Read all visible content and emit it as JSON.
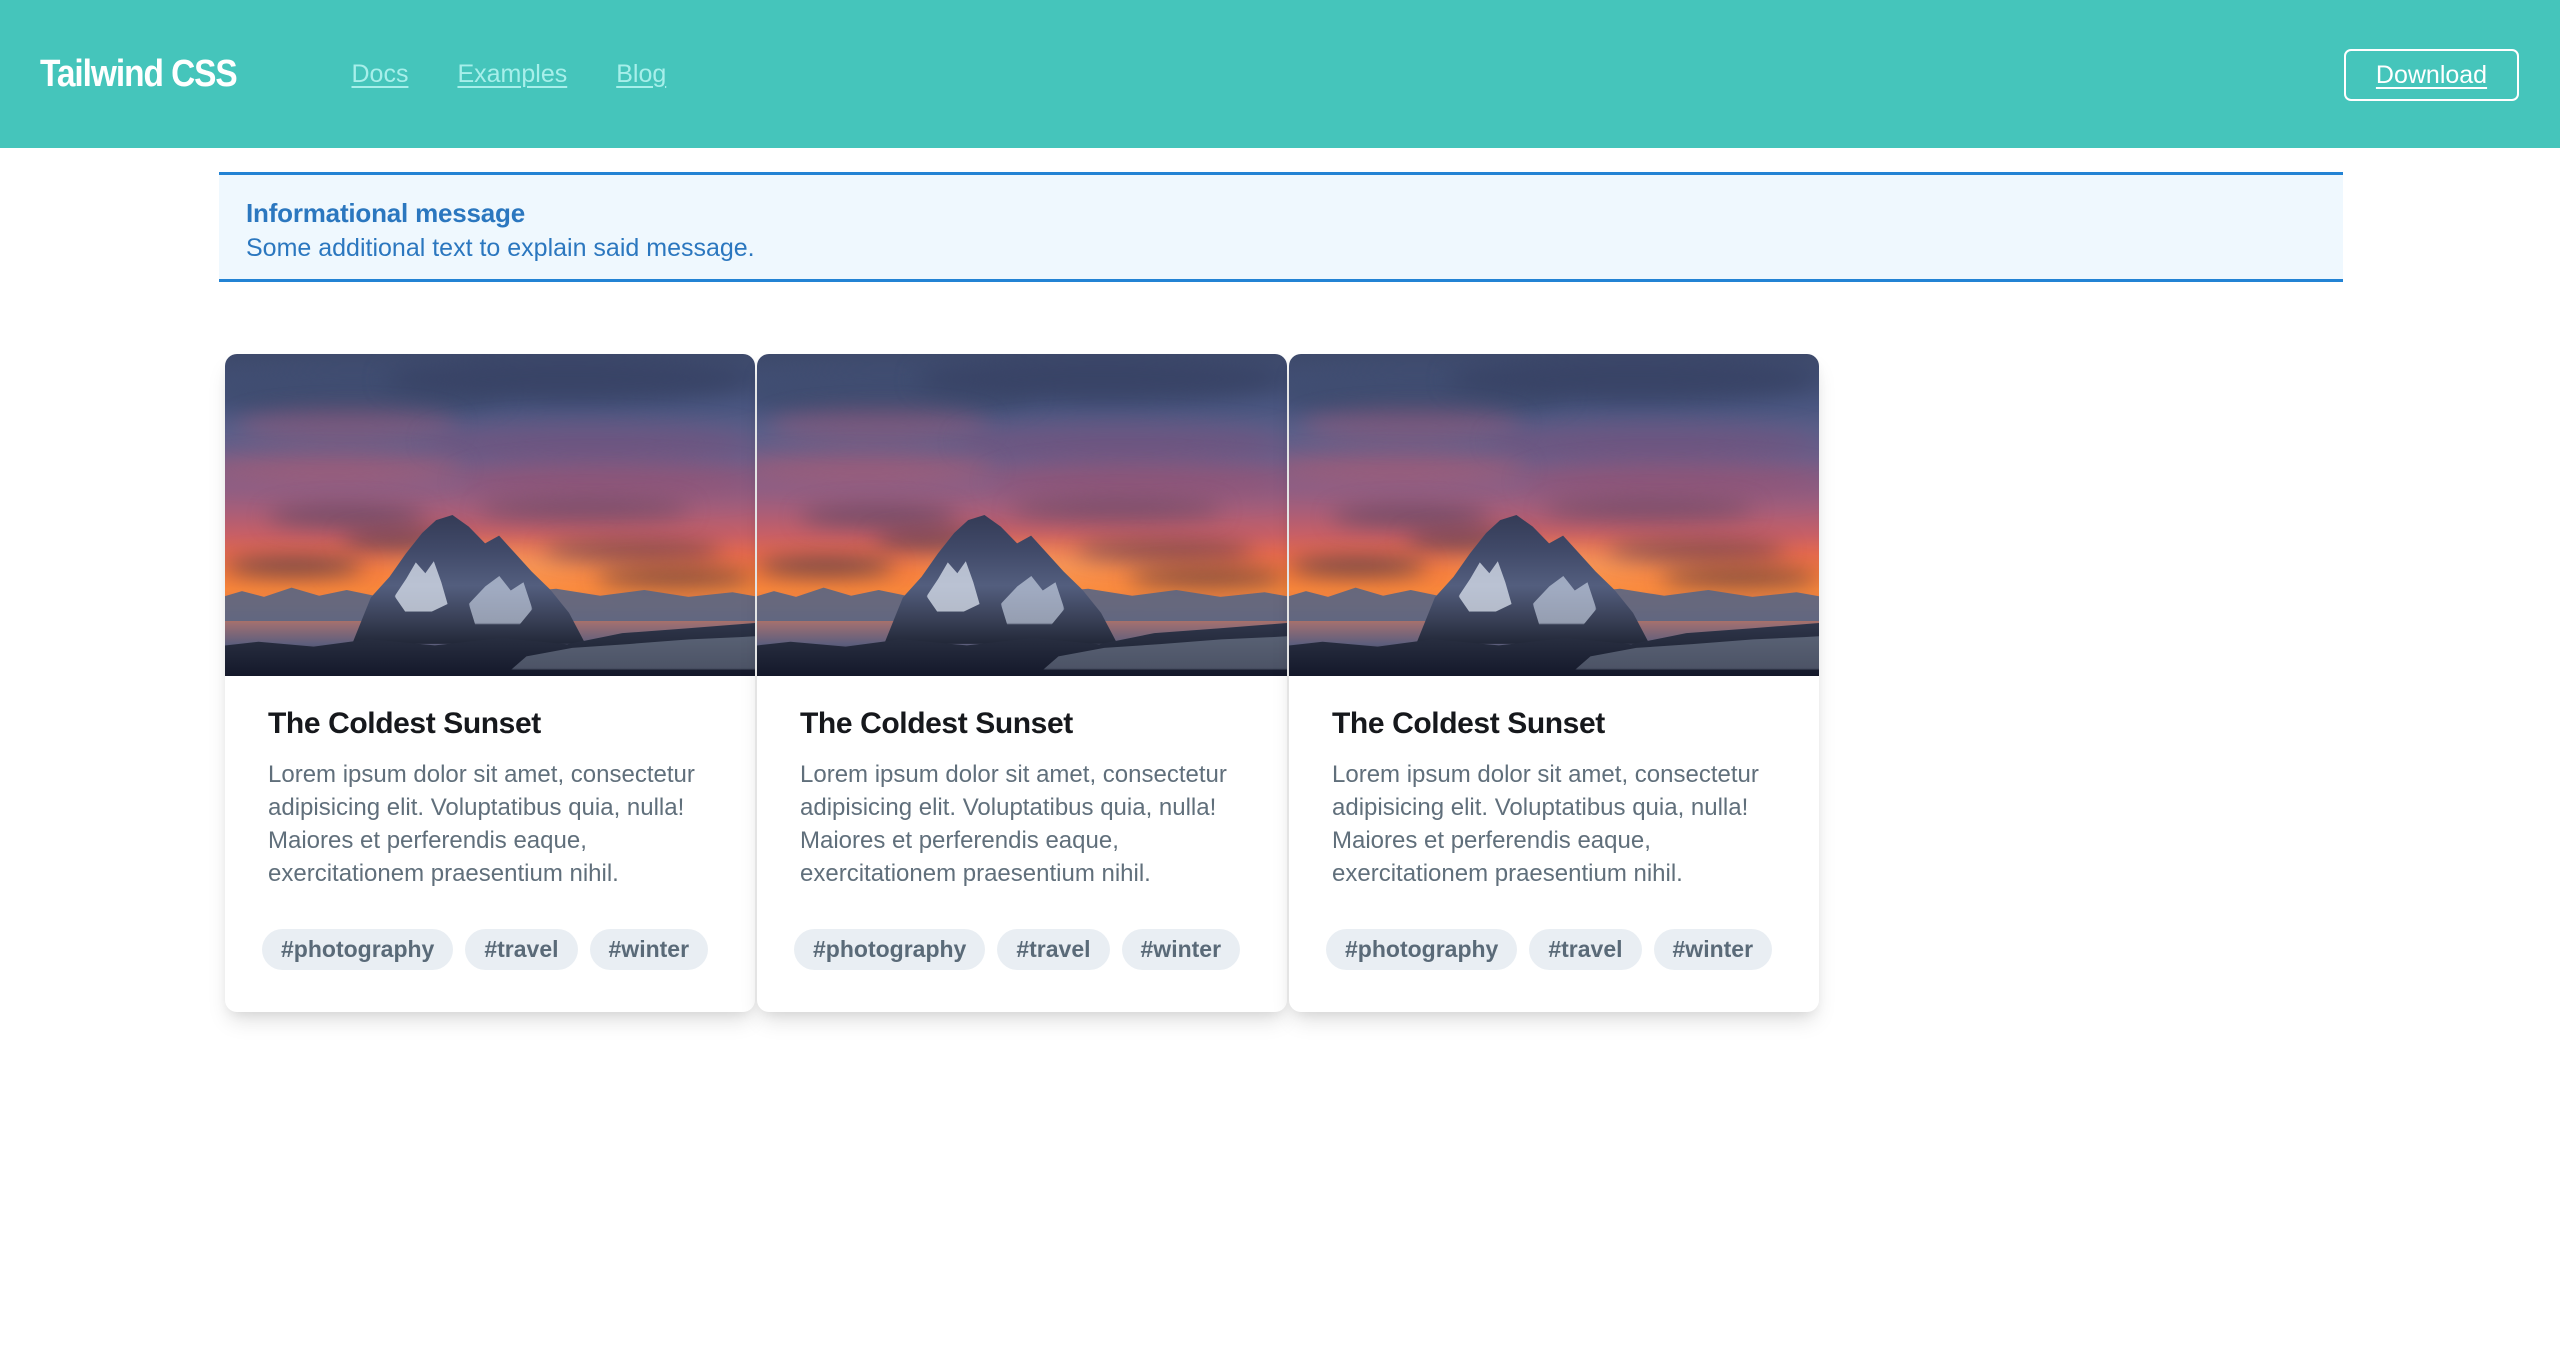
{
  "theme": {
    "nav_bg": "#45c5bb",
    "nav_link_color": "#a7efea",
    "alert_bg": "#eff8fe",
    "alert_border": "#2383d4",
    "alert_text": "#2b77bf",
    "tag_bg": "#e9eef3",
    "tag_text": "#5a6a78",
    "card_text": "#606f7b",
    "page_bg": "#ffffff"
  },
  "navbar": {
    "brand": "Tailwind CSS",
    "links": [
      {
        "label": "Docs"
      },
      {
        "label": "Examples"
      },
      {
        "label": "Blog"
      }
    ],
    "download_label": "Download"
  },
  "alert": {
    "title": "Informational message",
    "body": "Some additional text to explain said message."
  },
  "cards": [
    {
      "image_alt": "mountain-sunset-photo",
      "title": "The Coldest Sunset",
      "text": "Lorem ipsum dolor sit amet, consectetur adipisicing elit. Voluptatibus quia, nulla! Maiores et perferendis eaque, exercitationem praesentium nihil.",
      "tags": [
        "#photography",
        "#travel",
        "#winter"
      ]
    },
    {
      "image_alt": "mountain-sunset-photo",
      "title": "The Coldest Sunset",
      "text": "Lorem ipsum dolor sit amet, consectetur adipisicing elit. Voluptatibus quia, nulla! Maiores et perferendis eaque, exercitationem praesentium nihil.",
      "tags": [
        "#photography",
        "#travel",
        "#winter"
      ]
    },
    {
      "image_alt": "mountain-sunset-photo",
      "title": "The Coldest Sunset",
      "text": "Lorem ipsum dolor sit amet, consectetur adipisicing elit. Voluptatibus quia, nulla! Maiores et perferendis eaque, exercitationem praesentium nihil.",
      "tags": [
        "#photography",
        "#travel",
        "#winter"
      ]
    }
  ]
}
